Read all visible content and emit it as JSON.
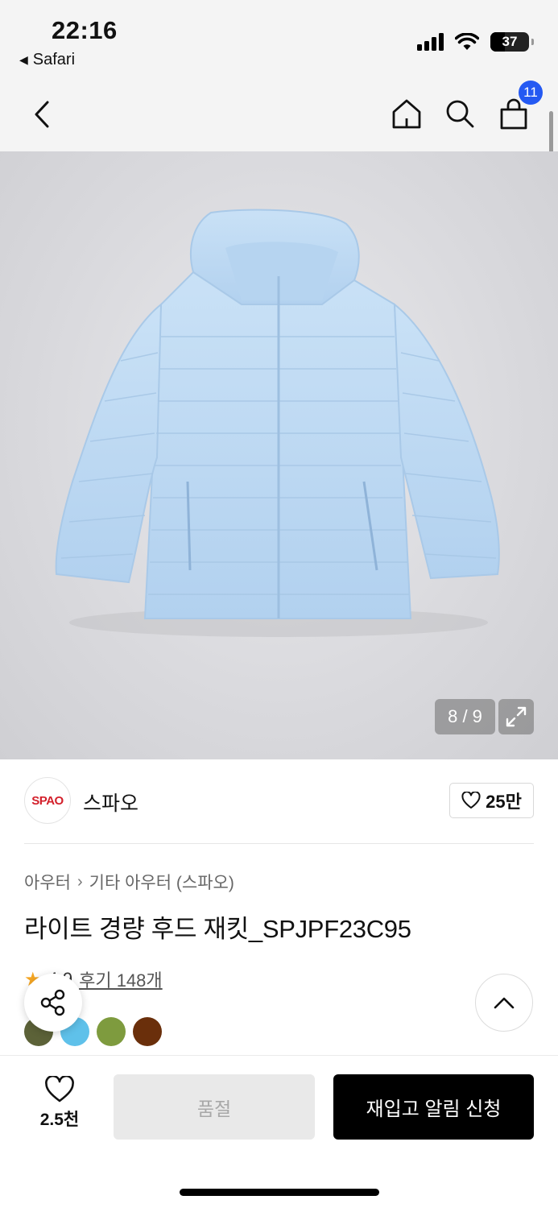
{
  "status_bar": {
    "time": "22:16",
    "back_app": "Safari",
    "battery": "37"
  },
  "header": {
    "cart_count": "11",
    "icons": [
      "back-chevron-icon",
      "home-icon",
      "search-icon",
      "shopping-bag-icon"
    ]
  },
  "gallery": {
    "counter": "8 / 9",
    "product_color": "#bcd9f3"
  },
  "brand": {
    "logo_text": "SPAO",
    "name": "스파오",
    "likes": "25만"
  },
  "breadcrumb": {
    "level1": "아우터",
    "level2": "기타 아우터 (스파오)"
  },
  "product": {
    "title": "라이트 경량 후드 재킷_SPJPF23C95",
    "rating": "4.9",
    "reviews": "후기 148개",
    "swatch_colors": [
      "#5c6238",
      "#5fc1ea",
      "#7e9b3e",
      "#6a2f0b"
    ]
  },
  "bottom_bar": {
    "wish_count": "2.5천",
    "soldout_label": "품절",
    "restock_label": "재입고 알림 신청"
  }
}
